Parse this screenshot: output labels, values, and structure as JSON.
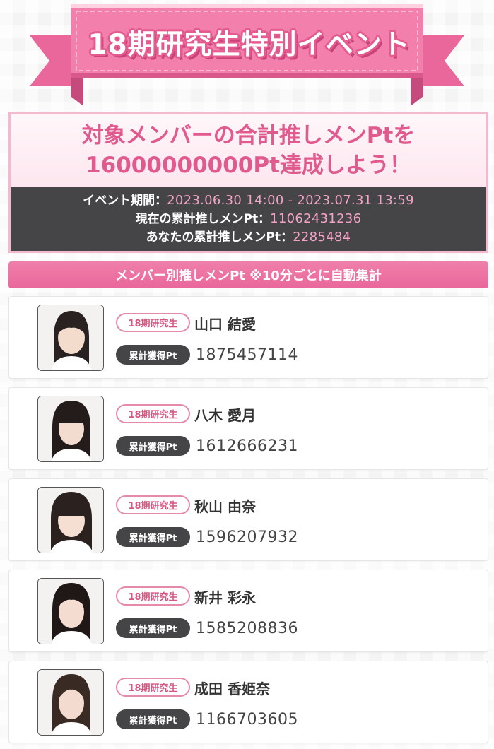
{
  "banner": {
    "title": "18期研究生特別イベント"
  },
  "goal": {
    "line1": "対象メンバーの合計推しメンPtを",
    "line2": "16000000000Pt達成しよう！",
    "period_label": "イベント期間：",
    "period_value": "2023.06.30 14:00 - 2023.07.31 13:59",
    "total_label": "現在の累計推しメンPt：",
    "total_value": "11062431236",
    "mine_label": "あなたの累計推しメンPt：",
    "mine_value": "2285484"
  },
  "section": {
    "title": "メンバー別推しメンPt ※10分ごとに自動集計"
  },
  "members": [
    {
      "tag": "18期研究生",
      "name": "山口 結愛",
      "pt_label": "累計獲得Pt",
      "pt": "1875457114",
      "photo_icon": "member-portrait"
    },
    {
      "tag": "18期研究生",
      "name": "八木 愛月",
      "pt_label": "累計獲得Pt",
      "pt": "1612666231",
      "photo_icon": "member-portrait"
    },
    {
      "tag": "18期研究生",
      "name": "秋山 由奈",
      "pt_label": "累計獲得Pt",
      "pt": "1596207932",
      "photo_icon": "member-portrait"
    },
    {
      "tag": "18期研究生",
      "name": "新井 彩永",
      "pt_label": "累計獲得Pt",
      "pt": "1585208836",
      "photo_icon": "member-portrait"
    },
    {
      "tag": "18期研究生",
      "name": "成田 香姫奈",
      "pt_label": "累計獲得Pt",
      "pt": "1166703605",
      "photo_icon": "member-portrait"
    }
  ],
  "colors": {
    "accent_pink": "#e9679a",
    "goal_text": "#e05a8e",
    "value_pink": "#f5a3c4",
    "dark_panel": "#454548"
  }
}
